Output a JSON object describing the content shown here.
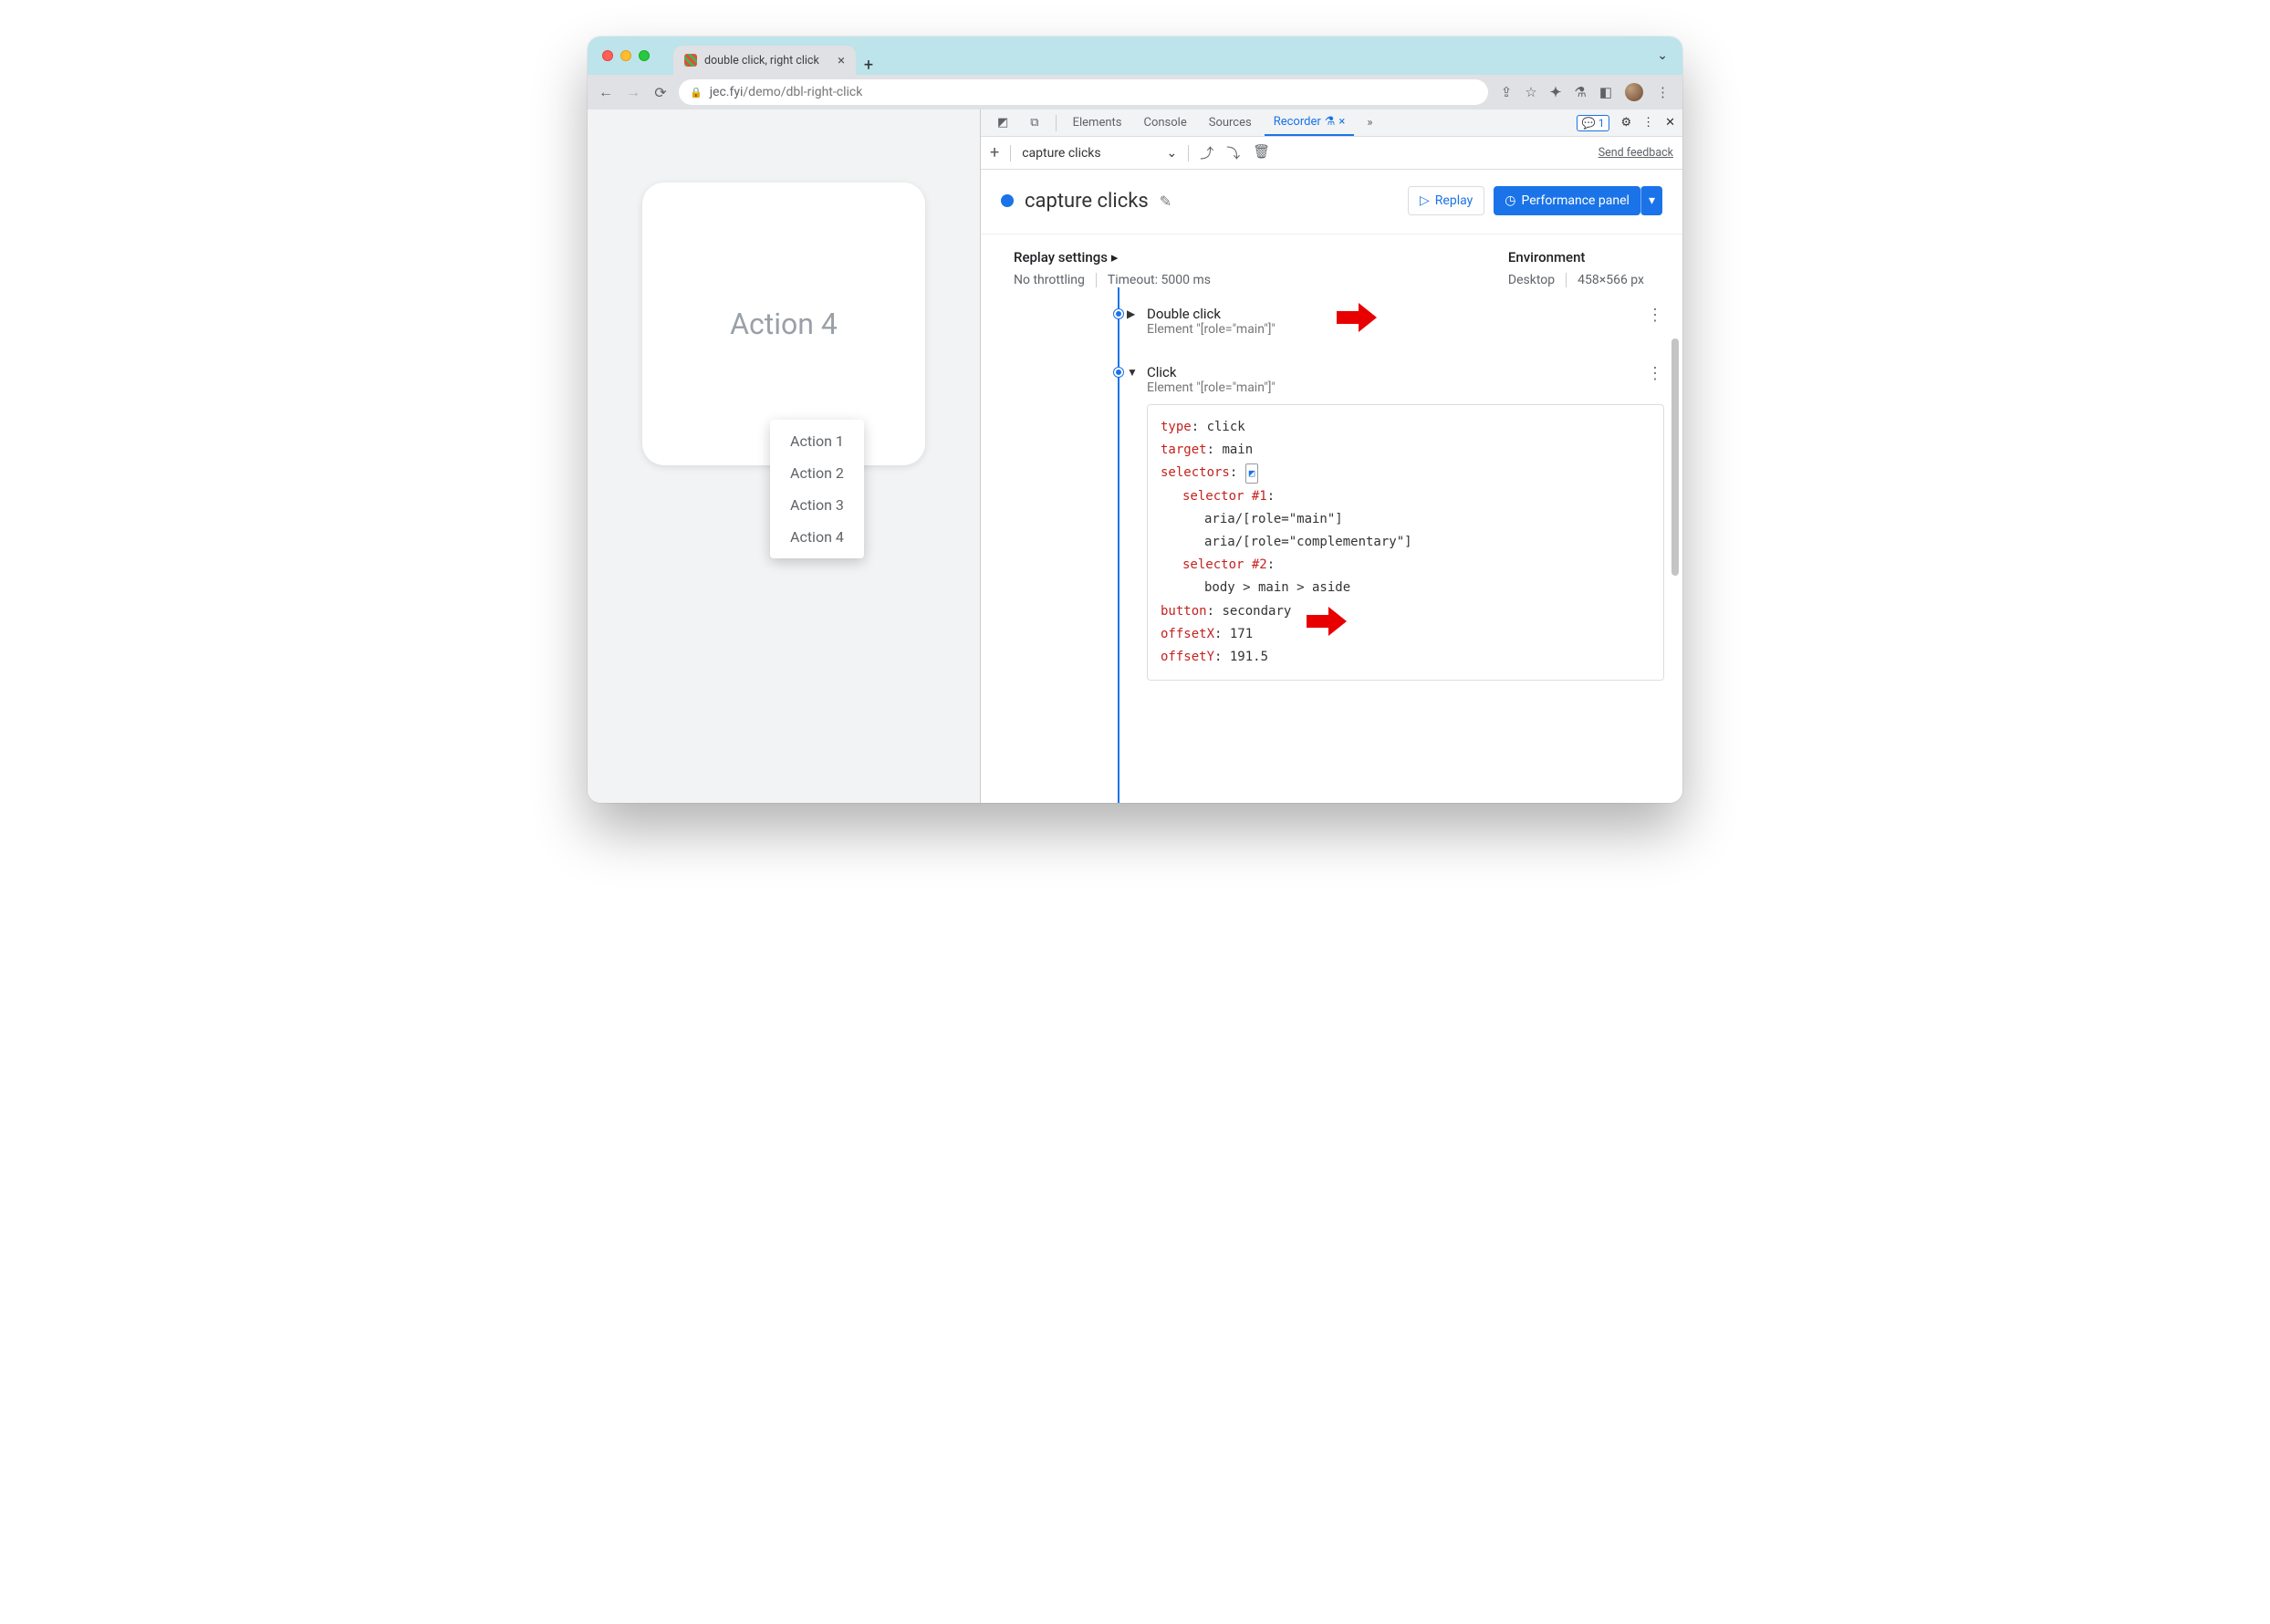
{
  "browser": {
    "tab_title": "double click, right click",
    "url_host": "jec.fyi",
    "url_path": "/demo/dbl-right-click"
  },
  "page": {
    "card_label": "Action 4",
    "menu_items": [
      "Action 1",
      "Action 2",
      "Action 3",
      "Action 4"
    ]
  },
  "devtools": {
    "tabs": [
      "Elements",
      "Console",
      "Sources",
      "Recorder"
    ],
    "active_tab": "Recorder",
    "issues_count": "1",
    "recording_select": "capture clicks",
    "send_feedback": "Send feedback",
    "recording_title": "capture clicks",
    "replay_button": "Replay",
    "perf_button": "Performance panel",
    "settings": {
      "replay_heading": "Replay settings",
      "throttling": "No throttling",
      "timeout": "Timeout: 5000 ms",
      "env_heading": "Environment",
      "device": "Desktop",
      "viewport": "458×566 px"
    },
    "steps": [
      {
        "expanded": false,
        "title": "Double click",
        "subtitle": "Element \"[role=\"main\"]\""
      },
      {
        "expanded": true,
        "title": "Click",
        "subtitle": "Element \"[role=\"main\"]\"",
        "details": {
          "type": "click",
          "target": "main",
          "selectors_label": "selectors",
          "selectors": [
            {
              "label": "selector #1",
              "lines": [
                "aria/[role=\"main\"]",
                "aria/[role=\"complementary\"]"
              ]
            },
            {
              "label": "selector #2",
              "lines": [
                "body > main > aside"
              ]
            }
          ],
          "button": "secondary",
          "offsetX": "171",
          "offsetY": "191.5"
        }
      }
    ]
  }
}
